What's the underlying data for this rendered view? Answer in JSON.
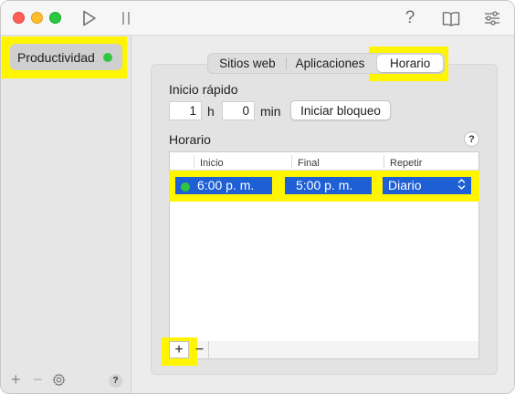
{
  "toolbar": {
    "play_icon": "play-icon",
    "pause_icon": "pause-icon",
    "help_label": "?",
    "book_icon": "book-icon",
    "sliders_icon": "sliders-icon"
  },
  "sidebar": {
    "items": [
      {
        "label": "Productividad",
        "status_color": "#2fc73f"
      }
    ],
    "add_label": "+",
    "remove_label": "−",
    "help_label": "?"
  },
  "tabs": [
    {
      "label": "Sitios web",
      "active": false
    },
    {
      "label": "Aplicaciones",
      "active": false
    },
    {
      "label": "Horario",
      "active": true
    }
  ],
  "quick_start": {
    "title": "Inicio rápido",
    "hours_value": "1",
    "hours_unit": "h",
    "minutes_value": "0",
    "minutes_unit": "min",
    "start_button": "Iniciar bloqueo"
  },
  "schedule": {
    "title": "Horario",
    "help_label": "?",
    "columns": [
      "Inicio",
      "Final",
      "Repetir"
    ],
    "rows": [
      {
        "start": "6:00 p. m.",
        "end": "5:00 p. m.",
        "repeat": "Diario",
        "status_color": "#2fc73f"
      }
    ],
    "add_label": "+",
    "remove_label": "−"
  },
  "colors": {
    "highlight": "#fff500",
    "selection": "#1e5fd6",
    "active_green": "#2fc73f"
  }
}
